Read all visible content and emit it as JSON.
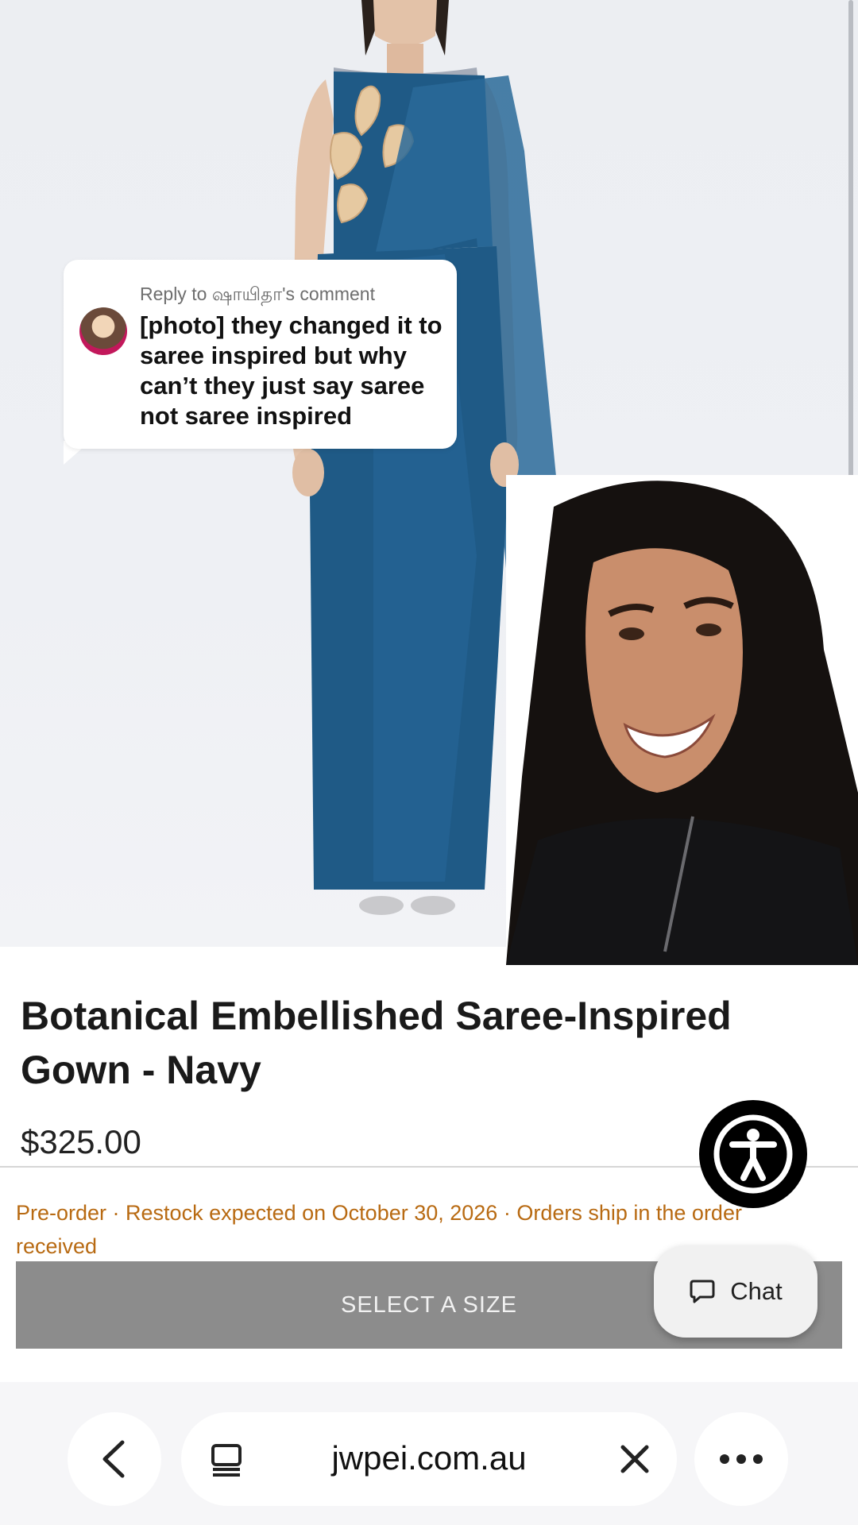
{
  "comment": {
    "reply_to": "Reply to ஷாயிதா's comment",
    "text": "[photo] they changed it to saree inspired but why can’t they just say saree not saree inspired"
  },
  "product": {
    "title": "Botanical Embellished Saree-Inspired Gown - Navy",
    "price": "$325.00",
    "availability": "Pre-order · Restock expected on October 30, 2026 · Orders ship in the order received",
    "select_size_label": "SELECT A SIZE",
    "chat_label": "Chat"
  },
  "browser": {
    "url": "jwpei.com.au"
  },
  "icons": {
    "accessibility": "accessibility-icon",
    "chat": "chat-bubble-icon",
    "back": "chevron-left-icon",
    "tabs": "tabs-icon",
    "close": "close-icon",
    "more": "more-dots-icon"
  },
  "colors": {
    "dress": "#1f5a86",
    "availability_text": "#b86a12",
    "button_bg": "#8c8c8c"
  }
}
